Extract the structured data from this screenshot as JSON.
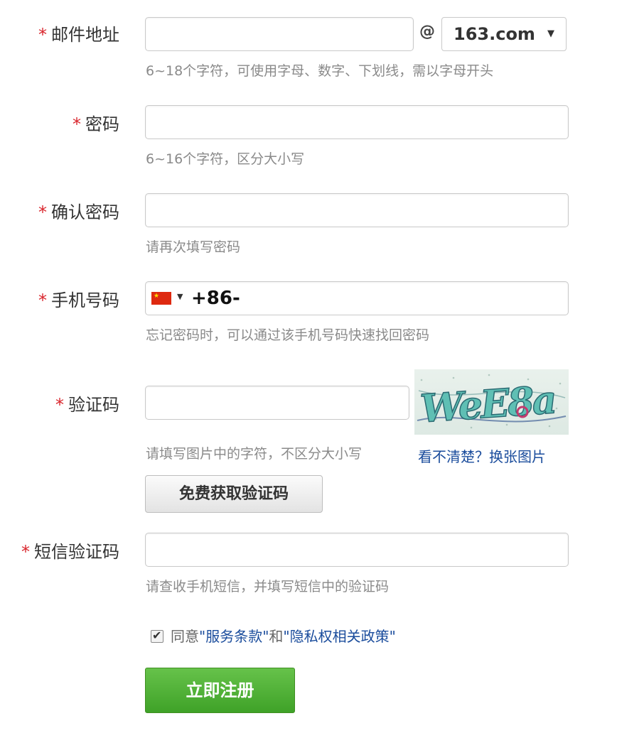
{
  "form": {
    "email": {
      "required_mark": "*",
      "label": "邮件地址",
      "at_sign": "@",
      "domain": "163.com",
      "hint": "6~18个字符，可使用字母、数字、下划线，需以字母开头",
      "value": ""
    },
    "password": {
      "required_mark": "*",
      "label": "密码",
      "hint": "6~16个字符，区分大小写",
      "value": ""
    },
    "confirm_password": {
      "required_mark": "*",
      "label": "确认密码",
      "hint": "请再次填写密码",
      "value": ""
    },
    "phone": {
      "required_mark": "*",
      "label": "手机号码",
      "country_flag": "china-flag-icon",
      "prefix": "+86-",
      "hint": "忘记密码时，可以通过该手机号码快速找回密码",
      "value": ""
    },
    "captcha": {
      "required_mark": "*",
      "label": "验证码",
      "image_text": "WeE8a",
      "hint": "请填写图片中的字符，不区分大小写",
      "refresh_link": "看不清楚？换张图片",
      "value": ""
    },
    "sms_button": "免费获取验证码",
    "sms_code": {
      "required_mark": "*",
      "label": "短信验证码",
      "hint": "请查收手机短信，并填写短信中的验证码",
      "value": ""
    },
    "agreement": {
      "checked": true,
      "prefix": "同意",
      "terms_link": "\"服务条款\"",
      "and": "和",
      "privacy_link": "\"隐私权相关政策\""
    },
    "submit_button": "立即注册"
  },
  "colors": {
    "required": "#d9252c",
    "link": "#1a4c9c",
    "submit": "#4cae32"
  }
}
